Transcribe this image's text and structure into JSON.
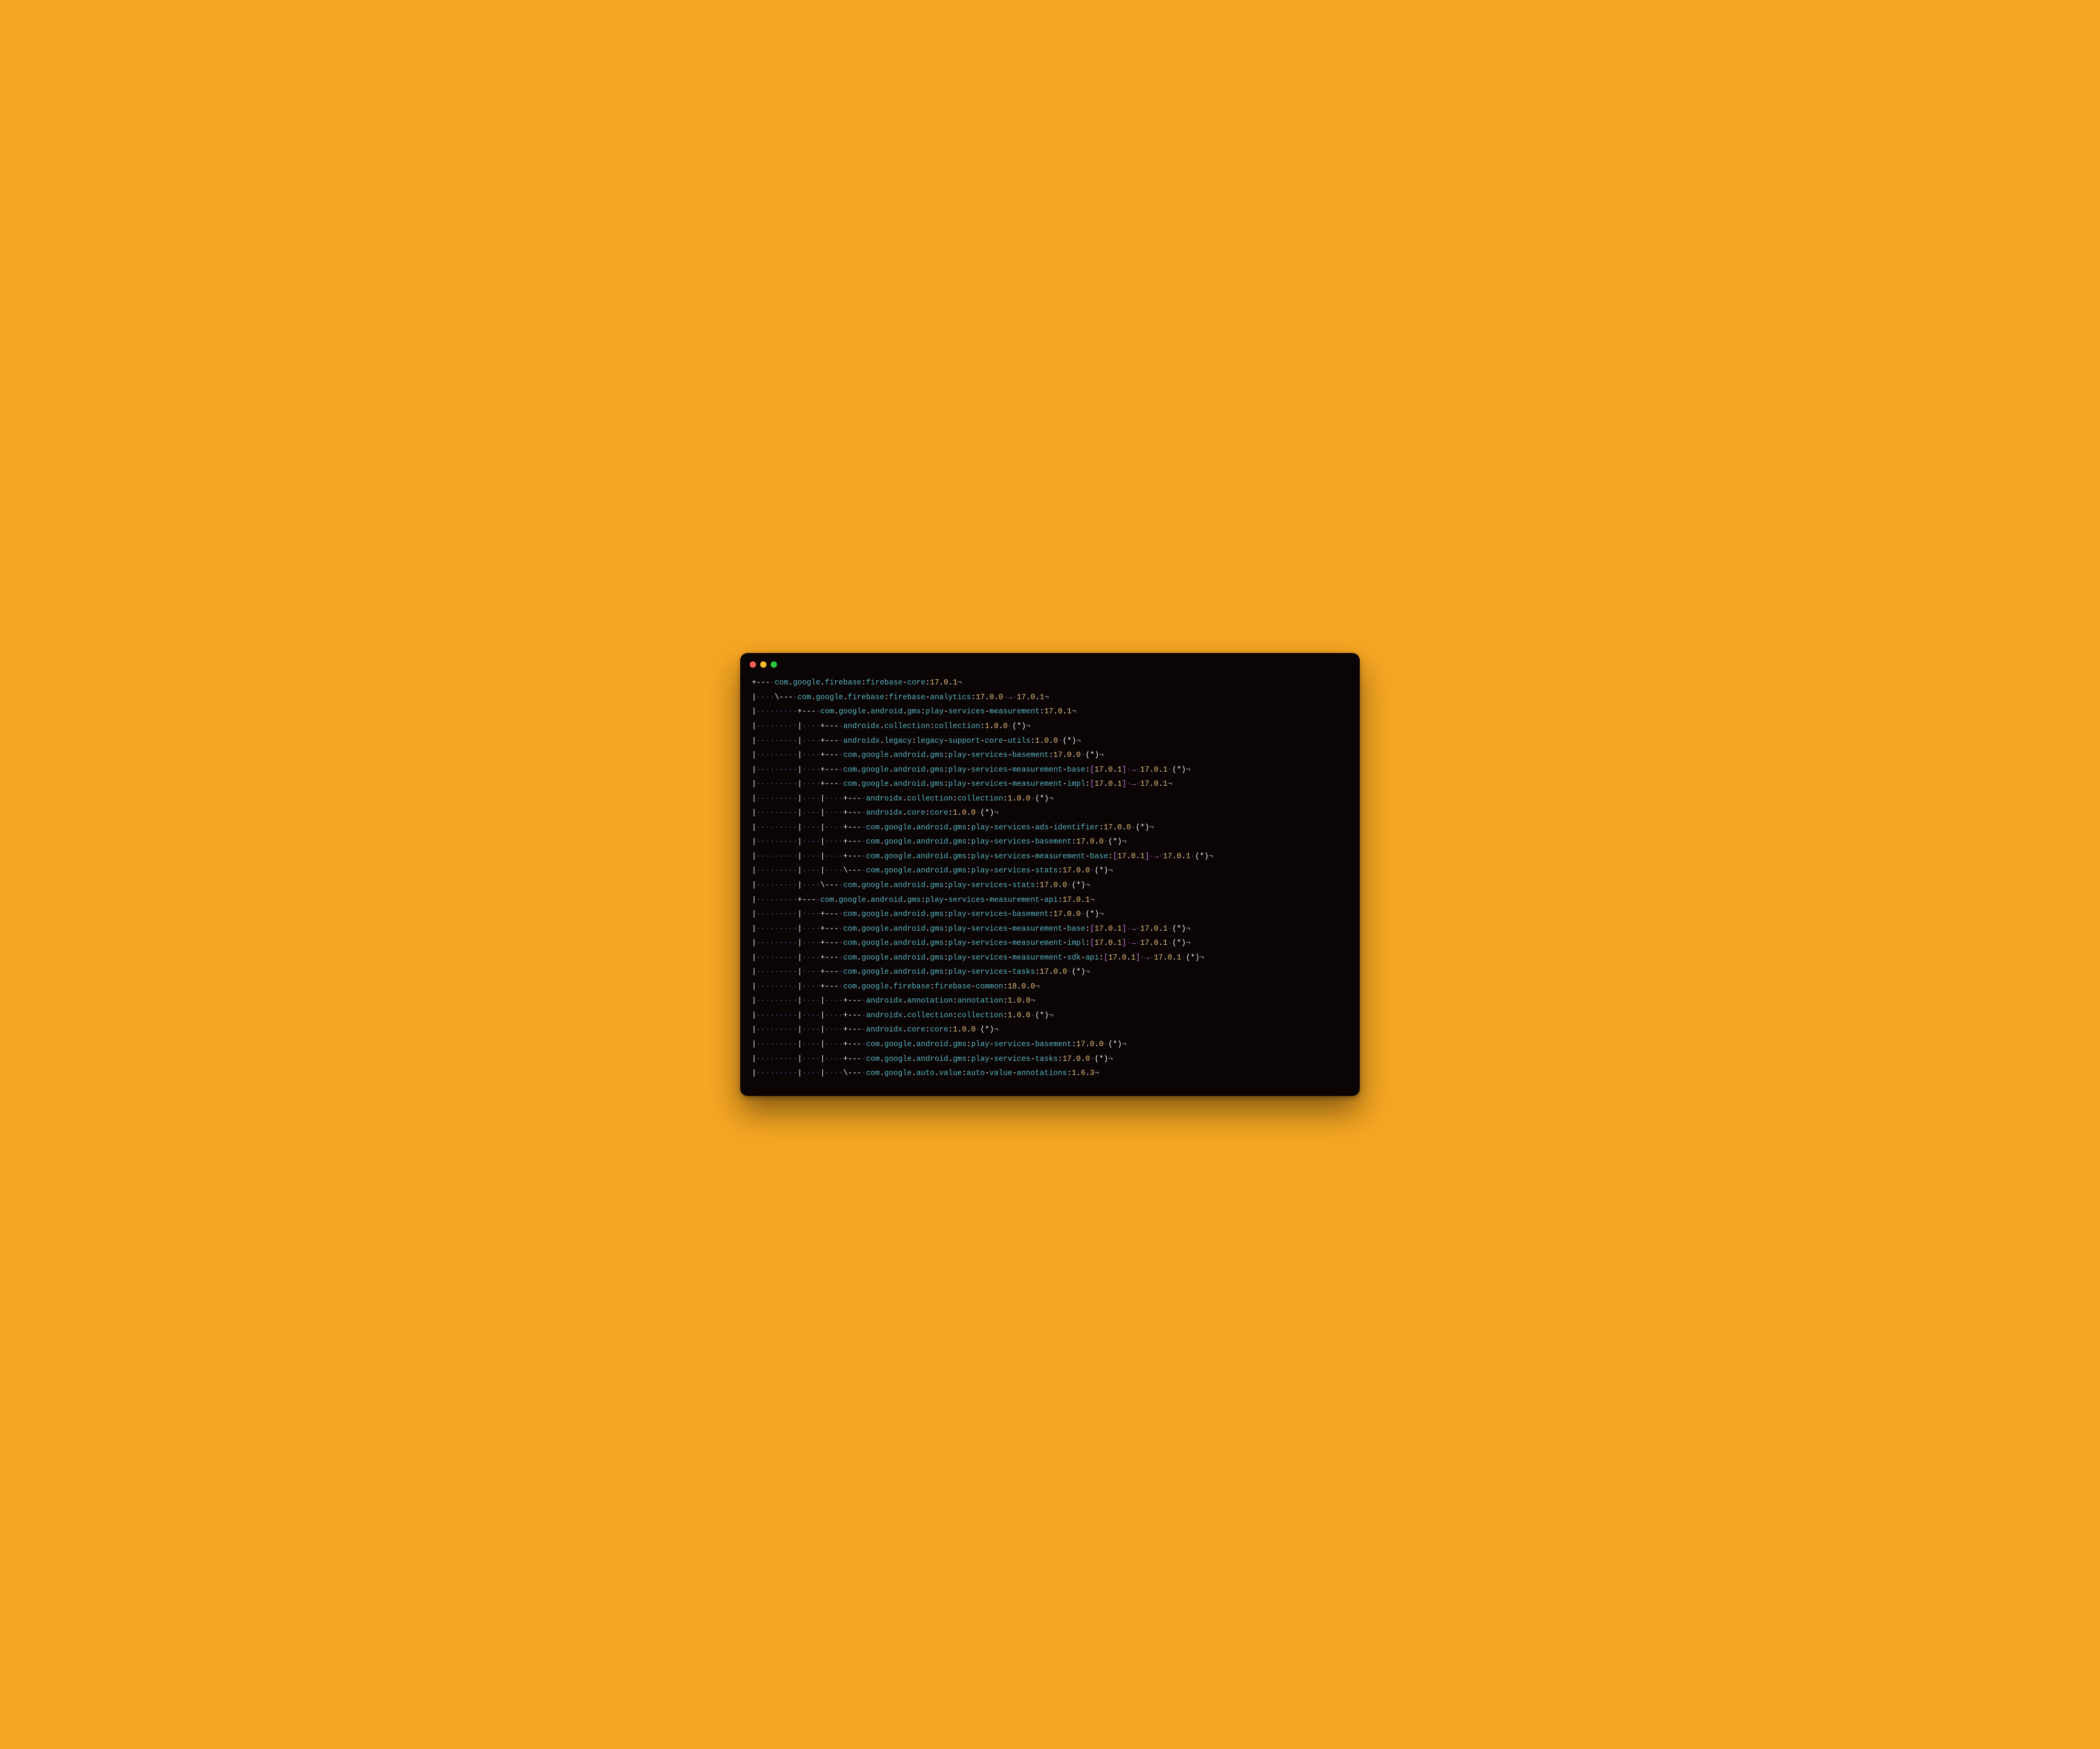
{
  "glyphs": {
    "dot": "·",
    "pilcrow": "¬",
    "arrow": "→",
    "star": "*"
  },
  "lines": [
    {
      "prefix": "+---·",
      "segs": [
        "com",
        ".",
        "google",
        ".",
        "firebase",
        ":",
        "firebase",
        "-",
        "core"
      ],
      "version": "17.0.1"
    },
    {
      "prefix": "|····\\---·",
      "segs": [
        "com",
        ".",
        "google",
        ".",
        "firebase",
        ":",
        "firebase",
        "-",
        "analytics"
      ],
      "version": "17.0.0",
      "arrow_to": "17.0.1"
    },
    {
      "prefix": "|·········+---·",
      "segs": [
        "com",
        ".",
        "google",
        ".",
        "android",
        ".",
        "gms",
        ":",
        "play",
        "-",
        "services",
        "-",
        "measurement"
      ],
      "version": "17.0.1"
    },
    {
      "prefix": "|·········|····+---·",
      "segs": [
        "androidx",
        ".",
        "collection",
        ":",
        "collection"
      ],
      "version": "1.0.0",
      "star": true
    },
    {
      "prefix": "|·········|····+---·",
      "segs": [
        "androidx",
        ".",
        "legacy",
        ":",
        "legacy",
        "-",
        "support",
        "-",
        "core",
        "-",
        "utils"
      ],
      "version": "1.0.0",
      "star": true
    },
    {
      "prefix": "|·········|····+---·",
      "segs": [
        "com",
        ".",
        "google",
        ".",
        "android",
        ".",
        "gms",
        ":",
        "play",
        "-",
        "services",
        "-",
        "basement"
      ],
      "version": "17.0.0",
      "star": true
    },
    {
      "prefix": "|·········|····+---·",
      "segs": [
        "com",
        ".",
        "google",
        ".",
        "android",
        ".",
        "gms",
        ":",
        "play",
        "-",
        "services",
        "-",
        "measurement",
        "-",
        "base"
      ],
      "bracket": "17.0.1",
      "arrow_to": "17.0.1",
      "star": true
    },
    {
      "prefix": "|·········|····+---·",
      "segs": [
        "com",
        ".",
        "google",
        ".",
        "android",
        ".",
        "gms",
        ":",
        "play",
        "-",
        "services",
        "-",
        "measurement",
        "-",
        "impl"
      ],
      "bracket": "17.0.1",
      "arrow_to": "17.0.1"
    },
    {
      "prefix": "|·········|····|····+---·",
      "segs": [
        "androidx",
        ".",
        "collection",
        ":",
        "collection"
      ],
      "version": "1.0.0",
      "star": true
    },
    {
      "prefix": "|·········|····|····+---·",
      "segs": [
        "androidx",
        ".",
        "core",
        ":",
        "core"
      ],
      "version": "1.0.0",
      "star": true
    },
    {
      "prefix": "|·········|····|····+---·",
      "segs": [
        "com",
        ".",
        "google",
        ".",
        "android",
        ".",
        "gms",
        ":",
        "play",
        "-",
        "services",
        "-",
        "ads",
        "-",
        "identifier"
      ],
      "version": "17.0.0",
      "star": true
    },
    {
      "prefix": "|·········|····|····+---·",
      "segs": [
        "com",
        ".",
        "google",
        ".",
        "android",
        ".",
        "gms",
        ":",
        "play",
        "-",
        "services",
        "-",
        "basement"
      ],
      "version": "17.0.0",
      "star": true
    },
    {
      "prefix": "|·········|····|····+---·",
      "segs": [
        "com",
        ".",
        "google",
        ".",
        "android",
        ".",
        "gms",
        ":",
        "play",
        "-",
        "services",
        "-",
        "measurement",
        "-",
        "base"
      ],
      "bracket": "17.0.1",
      "arrow_to": "17.0.1",
      "star": true
    },
    {
      "prefix": "|·········|····|····\\---·",
      "segs": [
        "com",
        ".",
        "google",
        ".",
        "android",
        ".",
        "gms",
        ":",
        "play",
        "-",
        "services",
        "-",
        "stats"
      ],
      "version": "17.0.0",
      "star": true
    },
    {
      "prefix": "|·········|····\\---·",
      "segs": [
        "com",
        ".",
        "google",
        ".",
        "android",
        ".",
        "gms",
        ":",
        "play",
        "-",
        "services",
        "-",
        "stats"
      ],
      "version": "17.0.0",
      "star": true
    },
    {
      "prefix": "|·········+---·",
      "segs": [
        "com",
        ".",
        "google",
        ".",
        "android",
        ".",
        "gms",
        ":",
        "play",
        "-",
        "services",
        "-",
        "measurement",
        "-",
        "api"
      ],
      "version": "17.0.1"
    },
    {
      "prefix": "|·········|····+---·",
      "segs": [
        "com",
        ".",
        "google",
        ".",
        "android",
        ".",
        "gms",
        ":",
        "play",
        "-",
        "services",
        "-",
        "basement"
      ],
      "version": "17.0.0",
      "star": true
    },
    {
      "prefix": "|·········|····+---·",
      "segs": [
        "com",
        ".",
        "google",
        ".",
        "android",
        ".",
        "gms",
        ":",
        "play",
        "-",
        "services",
        "-",
        "measurement",
        "-",
        "base"
      ],
      "bracket": "17.0.1",
      "arrow_to": "17.0.1",
      "star": true
    },
    {
      "prefix": "|·········|····+---·",
      "segs": [
        "com",
        ".",
        "google",
        ".",
        "android",
        ".",
        "gms",
        ":",
        "play",
        "-",
        "services",
        "-",
        "measurement",
        "-",
        "impl"
      ],
      "bracket": "17.0.1",
      "arrow_to": "17.0.1",
      "star": true
    },
    {
      "prefix": "|·········|····+---·",
      "segs": [
        "com",
        ".",
        "google",
        ".",
        "android",
        ".",
        "gms",
        ":",
        "play",
        "-",
        "services",
        "-",
        "measurement",
        "-",
        "sdk",
        "-",
        "api"
      ],
      "bracket": "17.0.1",
      "arrow_to": "17.0.1",
      "star": true
    },
    {
      "prefix": "|·········|····+---·",
      "segs": [
        "com",
        ".",
        "google",
        ".",
        "android",
        ".",
        "gms",
        ":",
        "play",
        "-",
        "services",
        "-",
        "tasks"
      ],
      "version": "17.0.0",
      "star": true
    },
    {
      "prefix": "|·········|····+---·",
      "segs": [
        "com",
        ".",
        "google",
        ".",
        "firebase",
        ":",
        "firebase",
        "-",
        "common"
      ],
      "version": "18.0.0"
    },
    {
      "prefix": "|·········|····|····+---·",
      "segs": [
        "androidx",
        ".",
        "annotation",
        ":",
        "annotation"
      ],
      "version": "1.0.0"
    },
    {
      "prefix": "|·········|····|····+---·",
      "segs": [
        "androidx",
        ".",
        "collection",
        ":",
        "collection"
      ],
      "version": "1.0.0",
      "star": true
    },
    {
      "prefix": "|·········|····|····+---·",
      "segs": [
        "androidx",
        ".",
        "core",
        ":",
        "core"
      ],
      "version": "1.0.0",
      "star": true
    },
    {
      "prefix": "|·········|····|····+---·",
      "segs": [
        "com",
        ".",
        "google",
        ".",
        "android",
        ".",
        "gms",
        ":",
        "play",
        "-",
        "services",
        "-",
        "basement"
      ],
      "version": "17.0.0",
      "star": true
    },
    {
      "prefix": "|·········|····|····+---·",
      "segs": [
        "com",
        ".",
        "google",
        ".",
        "android",
        ".",
        "gms",
        ":",
        "play",
        "-",
        "services",
        "-",
        "tasks"
      ],
      "version": "17.0.0",
      "star": true
    },
    {
      "prefix": "|·········|····|····\\---·",
      "segs": [
        "com",
        ".",
        "google",
        ".",
        "auto",
        ".",
        "value",
        ":",
        "auto",
        "-",
        "value",
        "-",
        "annotations"
      ],
      "version": "1.6.3"
    }
  ]
}
